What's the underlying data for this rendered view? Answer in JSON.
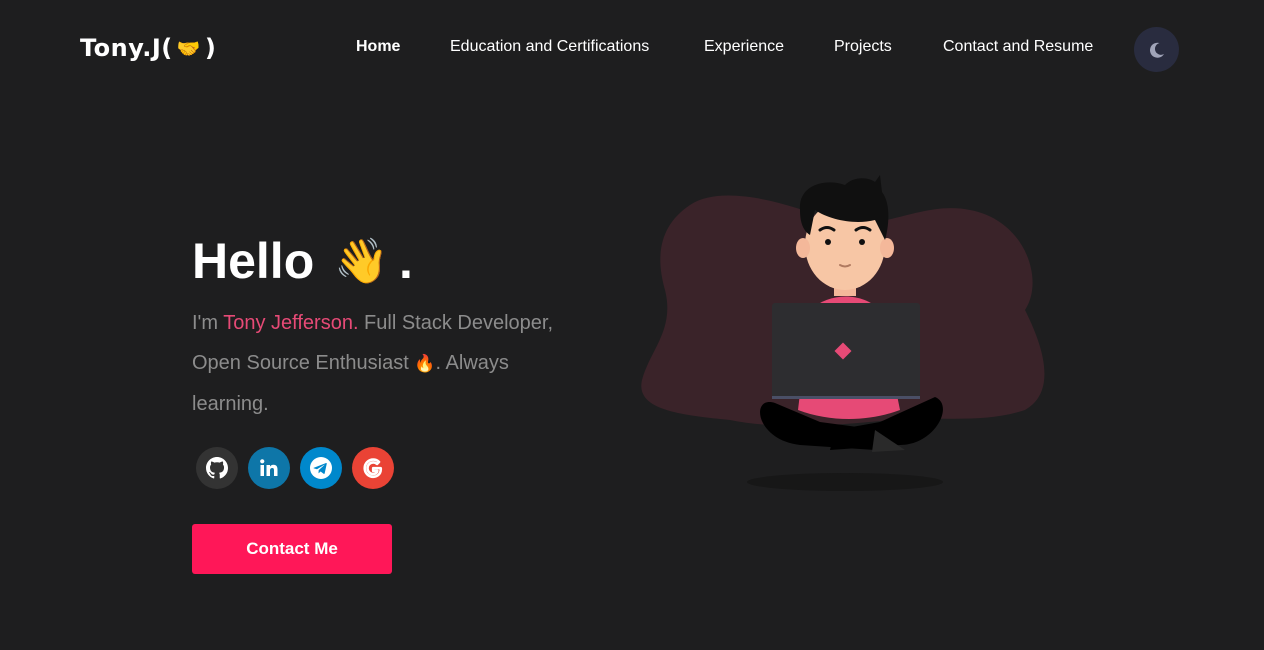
{
  "header": {
    "logo_name": "Tony.J",
    "logo_open": "(",
    "logo_emoji": "🤝",
    "logo_close": ")"
  },
  "nav": {
    "items": [
      {
        "label": "Home",
        "active": true
      },
      {
        "label": "Education and Certifications"
      },
      {
        "label": "Experience"
      },
      {
        "label": "Projects"
      },
      {
        "label": "Contact and Resume"
      }
    ],
    "theme_toggle_icon": "moon-icon"
  },
  "hero": {
    "greeting": "Hello",
    "wave_emoji": "👋",
    "greeting_end": ".",
    "intro_prefix": "I'm ",
    "intro_name": "Tony Jefferson.",
    "intro_middle": " Full Stack Developer, Open Source Enthusiast ",
    "intro_emoji": "🔥",
    "intro_suffix": ". Always learning.",
    "contact_button": "Contact Me"
  },
  "socials": [
    {
      "icon": "github-icon",
      "color": "#333333"
    },
    {
      "icon": "linkedin-icon",
      "color": "#0e76a8"
    },
    {
      "icon": "telegram-icon",
      "color": "#0088cc"
    },
    {
      "icon": "google-icon",
      "color": "#ea4335"
    }
  ],
  "colors": {
    "background": "#1e1e1f",
    "accent": "#ff1758",
    "name_highlight": "#e64a76",
    "toggle_bg": "#292c3f"
  }
}
